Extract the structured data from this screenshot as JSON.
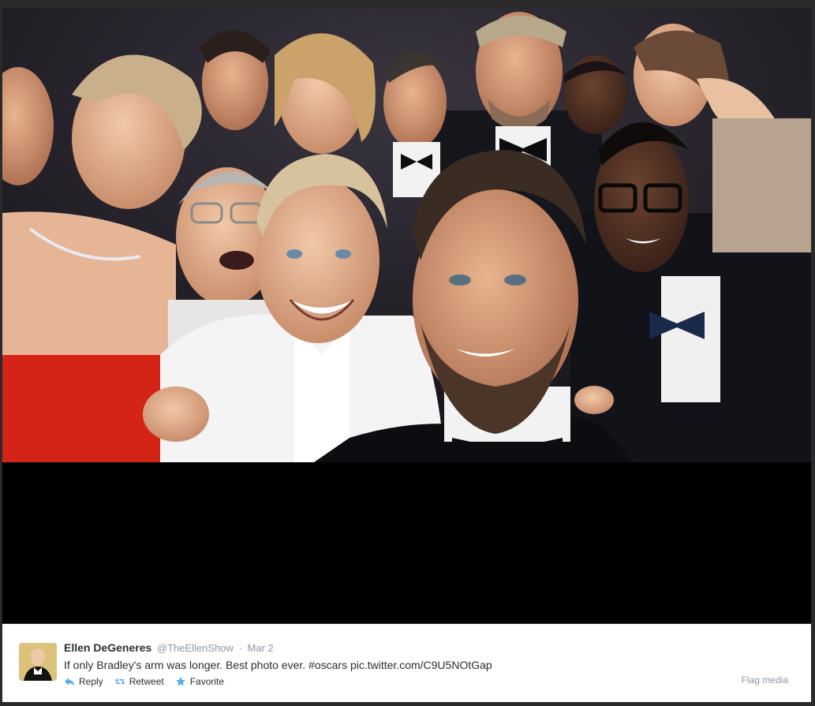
{
  "photo": {
    "alt_name": "group-selfie-photo"
  },
  "tweet": {
    "author": {
      "full_name": "Ellen DeGeneres",
      "username": "@TheEllenShow",
      "avatar_icon": "user-avatar"
    },
    "separator": "·",
    "timestamp": "Mar 2",
    "text": "If only Bradley's arm was longer. Best photo ever. #oscars pic.twitter.com/C9U5NOtGap",
    "actions": {
      "reply": {
        "label": "Reply",
        "icon": "reply-icon"
      },
      "retweet": {
        "label": "Retweet",
        "icon": "retweet-icon"
      },
      "favorite": {
        "label": "Favorite",
        "icon": "star-icon"
      }
    },
    "flag_label": "Flag media"
  },
  "colors": {
    "accent": "#55acee",
    "text": "#292f33",
    "muted": "#8899a6",
    "dress_red": "#d42418"
  }
}
